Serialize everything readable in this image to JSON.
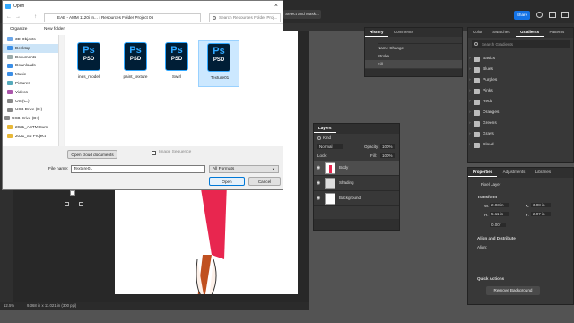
{
  "ps": {
    "top_selects": [
      "Select and Mask..."
    ],
    "share": "Share",
    "status_zoom": "12.5%",
    "status_doc": "9.368 in x 11.021 in (300 ppi)",
    "search_placeholder": ""
  },
  "history": {
    "tabs": [
      "History",
      "Comments"
    ],
    "items": [
      "Name Change",
      "Stroke",
      "Fill"
    ]
  },
  "layers": {
    "tab": "Layers",
    "kind": "Kind",
    "blend": "Normal",
    "opacity_label": "Opacity:",
    "opacity": "100%",
    "lock_label": "Lock:",
    "fill_label": "Fill:",
    "fill": "100%",
    "rows": [
      "Body",
      "Shading",
      "Background"
    ]
  },
  "gradients": {
    "tabs": [
      "Color",
      "Swatches",
      "Gradients",
      "Patterns"
    ],
    "search_placeholder": "Search Gradients",
    "folders": [
      "Basics",
      "Blues",
      "Purples",
      "Pinks",
      "Reds",
      "Oranges",
      "Greens",
      "Grays",
      "Cloud"
    ]
  },
  "properties": {
    "tabs": [
      "Properties",
      "Adjustments",
      "Libraries"
    ],
    "pixel_layer": "Pixel Layer",
    "transform": "Transform",
    "w_label": "W:",
    "w": "2.03 in",
    "h_label": "H:",
    "h": "5.11 in",
    "x_label": "X:",
    "x": "3.08 in",
    "y_label": "Y:",
    "y": "2.07 in",
    "angle": "0.00°",
    "align": "Align and Distribute",
    "align_sub": "Align:",
    "quick": "Quick Actions",
    "remove_bg": "Remove Background"
  },
  "dialog": {
    "title": "Open",
    "breadcrumb": [
      "EAB - AMM 1120i In...",
      "Resources Folder Project 06"
    ],
    "search_placeholder": "Search Resources Folder Proj...",
    "organize": "Organize",
    "new_folder": "New folder",
    "nav": [
      "3D Objects",
      "Desktop",
      "Documents",
      "Downloads",
      "Music",
      "Pictures",
      "Videos",
      "OS (C:)",
      "USB Drive (E:)",
      "USB Drive (D:)",
      "2021_ASTM Sum",
      "2021_Su Project"
    ],
    "files": [
      {
        "name": "ines_model",
        "label": "PSD",
        "glyph": "Ps"
      },
      {
        "name": "paint_texture",
        "label": "PSD",
        "glyph": "Ps"
      },
      {
        "name": "Swirl",
        "label": "PSD",
        "glyph": "Ps"
      },
      {
        "name": "Texture01",
        "label": "PSD",
        "glyph": "Ps"
      }
    ],
    "open_cloud": "Open cloud documents",
    "image_sequence": "Image Sequence",
    "filename_label": "File name:",
    "filename": "Texture01",
    "format": "All Formats",
    "open": "Open",
    "cancel": "Cancel"
  }
}
